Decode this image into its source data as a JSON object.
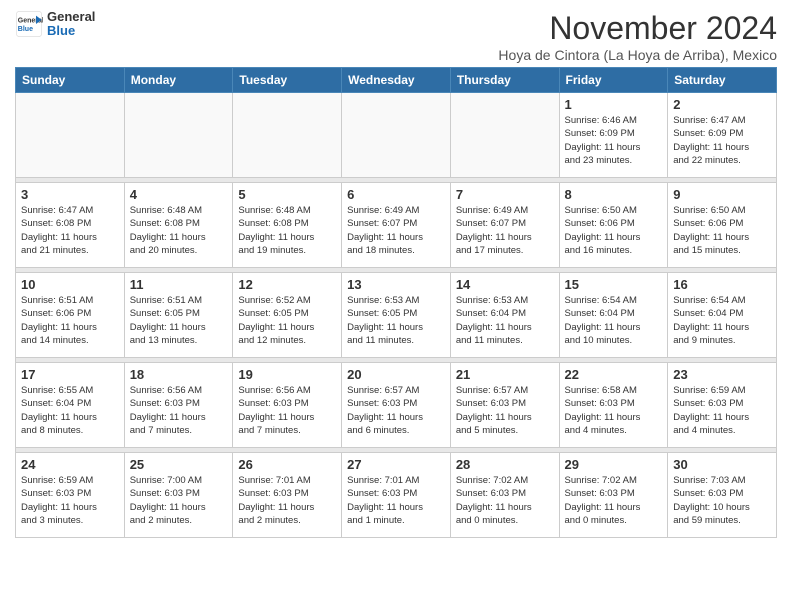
{
  "header": {
    "logo_general": "General",
    "logo_blue": "Blue",
    "month": "November 2024",
    "location": "Hoya de Cintora (La Hoya de Arriba), Mexico"
  },
  "weekdays": [
    "Sunday",
    "Monday",
    "Tuesday",
    "Wednesday",
    "Thursday",
    "Friday",
    "Saturday"
  ],
  "weeks": [
    [
      {
        "day": "",
        "info": ""
      },
      {
        "day": "",
        "info": ""
      },
      {
        "day": "",
        "info": ""
      },
      {
        "day": "",
        "info": ""
      },
      {
        "day": "",
        "info": ""
      },
      {
        "day": "1",
        "info": "Sunrise: 6:46 AM\nSunset: 6:09 PM\nDaylight: 11 hours\nand 23 minutes."
      },
      {
        "day": "2",
        "info": "Sunrise: 6:47 AM\nSunset: 6:09 PM\nDaylight: 11 hours\nand 22 minutes."
      }
    ],
    [
      {
        "day": "3",
        "info": "Sunrise: 6:47 AM\nSunset: 6:08 PM\nDaylight: 11 hours\nand 21 minutes."
      },
      {
        "day": "4",
        "info": "Sunrise: 6:48 AM\nSunset: 6:08 PM\nDaylight: 11 hours\nand 20 minutes."
      },
      {
        "day": "5",
        "info": "Sunrise: 6:48 AM\nSunset: 6:08 PM\nDaylight: 11 hours\nand 19 minutes."
      },
      {
        "day": "6",
        "info": "Sunrise: 6:49 AM\nSunset: 6:07 PM\nDaylight: 11 hours\nand 18 minutes."
      },
      {
        "day": "7",
        "info": "Sunrise: 6:49 AM\nSunset: 6:07 PM\nDaylight: 11 hours\nand 17 minutes."
      },
      {
        "day": "8",
        "info": "Sunrise: 6:50 AM\nSunset: 6:06 PM\nDaylight: 11 hours\nand 16 minutes."
      },
      {
        "day": "9",
        "info": "Sunrise: 6:50 AM\nSunset: 6:06 PM\nDaylight: 11 hours\nand 15 minutes."
      }
    ],
    [
      {
        "day": "10",
        "info": "Sunrise: 6:51 AM\nSunset: 6:06 PM\nDaylight: 11 hours\nand 14 minutes."
      },
      {
        "day": "11",
        "info": "Sunrise: 6:51 AM\nSunset: 6:05 PM\nDaylight: 11 hours\nand 13 minutes."
      },
      {
        "day": "12",
        "info": "Sunrise: 6:52 AM\nSunset: 6:05 PM\nDaylight: 11 hours\nand 12 minutes."
      },
      {
        "day": "13",
        "info": "Sunrise: 6:53 AM\nSunset: 6:05 PM\nDaylight: 11 hours\nand 11 minutes."
      },
      {
        "day": "14",
        "info": "Sunrise: 6:53 AM\nSunset: 6:04 PM\nDaylight: 11 hours\nand 11 minutes."
      },
      {
        "day": "15",
        "info": "Sunrise: 6:54 AM\nSunset: 6:04 PM\nDaylight: 11 hours\nand 10 minutes."
      },
      {
        "day": "16",
        "info": "Sunrise: 6:54 AM\nSunset: 6:04 PM\nDaylight: 11 hours\nand 9 minutes."
      }
    ],
    [
      {
        "day": "17",
        "info": "Sunrise: 6:55 AM\nSunset: 6:04 PM\nDaylight: 11 hours\nand 8 minutes."
      },
      {
        "day": "18",
        "info": "Sunrise: 6:56 AM\nSunset: 6:03 PM\nDaylight: 11 hours\nand 7 minutes."
      },
      {
        "day": "19",
        "info": "Sunrise: 6:56 AM\nSunset: 6:03 PM\nDaylight: 11 hours\nand 7 minutes."
      },
      {
        "day": "20",
        "info": "Sunrise: 6:57 AM\nSunset: 6:03 PM\nDaylight: 11 hours\nand 6 minutes."
      },
      {
        "day": "21",
        "info": "Sunrise: 6:57 AM\nSunset: 6:03 PM\nDaylight: 11 hours\nand 5 minutes."
      },
      {
        "day": "22",
        "info": "Sunrise: 6:58 AM\nSunset: 6:03 PM\nDaylight: 11 hours\nand 4 minutes."
      },
      {
        "day": "23",
        "info": "Sunrise: 6:59 AM\nSunset: 6:03 PM\nDaylight: 11 hours\nand 4 minutes."
      }
    ],
    [
      {
        "day": "24",
        "info": "Sunrise: 6:59 AM\nSunset: 6:03 PM\nDaylight: 11 hours\nand 3 minutes."
      },
      {
        "day": "25",
        "info": "Sunrise: 7:00 AM\nSunset: 6:03 PM\nDaylight: 11 hours\nand 2 minutes."
      },
      {
        "day": "26",
        "info": "Sunrise: 7:01 AM\nSunset: 6:03 PM\nDaylight: 11 hours\nand 2 minutes."
      },
      {
        "day": "27",
        "info": "Sunrise: 7:01 AM\nSunset: 6:03 PM\nDaylight: 11 hours\nand 1 minute."
      },
      {
        "day": "28",
        "info": "Sunrise: 7:02 AM\nSunset: 6:03 PM\nDaylight: 11 hours\nand 0 minutes."
      },
      {
        "day": "29",
        "info": "Sunrise: 7:02 AM\nSunset: 6:03 PM\nDaylight: 11 hours\nand 0 minutes."
      },
      {
        "day": "30",
        "info": "Sunrise: 7:03 AM\nSunset: 6:03 PM\nDaylight: 10 hours\nand 59 minutes."
      }
    ]
  ]
}
